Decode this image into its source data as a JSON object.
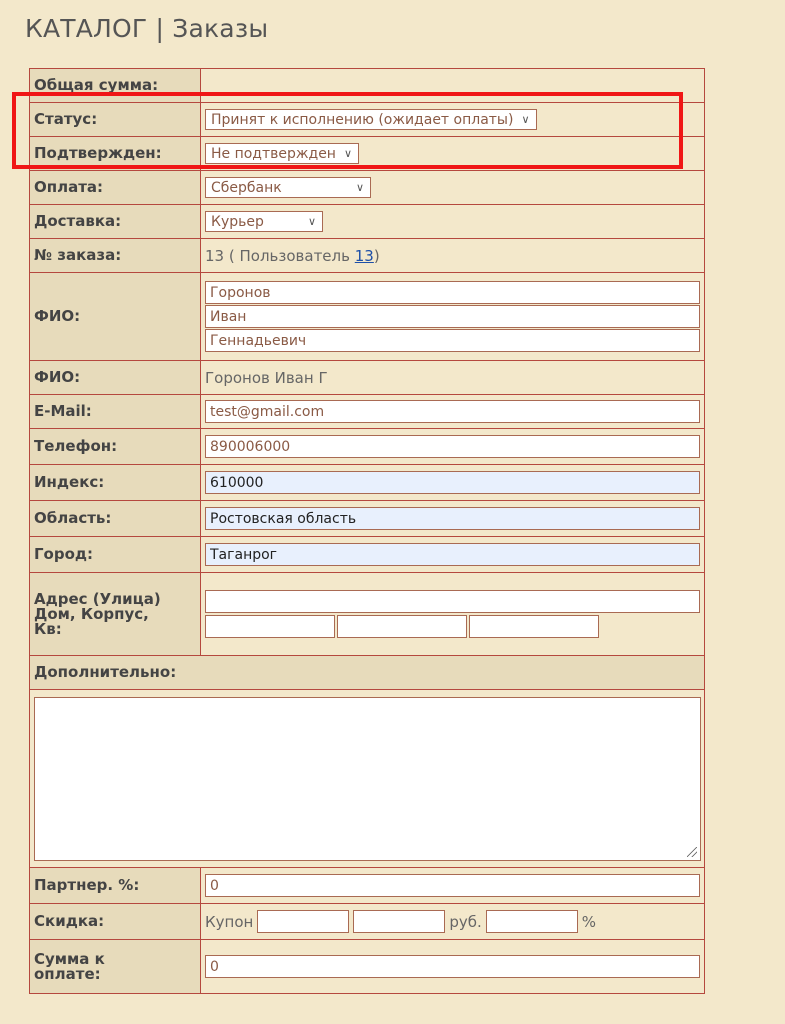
{
  "page": {
    "title": "КАТАЛОГ | Заказы"
  },
  "form": {
    "total_label": "Общая сумма:",
    "total_value": "",
    "status_label": "Статус:",
    "status_value": "Принят к исполнению (ожидает оплаты)",
    "confirmed_label": "Подтвержден:",
    "confirmed_value": "Не подтвержден",
    "payment_label": "Оплата:",
    "payment_value": "Сбербанк",
    "delivery_label": "Доставка:",
    "delivery_value": "Курьер",
    "order_no_label": "№ заказа:",
    "order_no_value": "13",
    "order_user_prefix": "( Пользователь",
    "order_user_id": "13",
    "order_user_suffix": ")",
    "fio_label": "ФИО:",
    "fio_last": "Горонов",
    "fio_first": "Иван",
    "fio_middle": "Геннадьевич",
    "fio2_label": "ФИО:",
    "fio2_value": "Горонов Иван Г",
    "email_label": "E-Mail:",
    "email_value": "test@gmail.com",
    "phone_label": "Телефон:",
    "phone_value": "890006000",
    "index_label": "Индекс:",
    "index_value": "610000",
    "region_label": "Область:",
    "region_value": "Ростовская область",
    "city_label": "Город:",
    "city_value": "Таганрог",
    "address_label_1": "Адрес (Улица)",
    "address_label_2": "Дом, Корпус,",
    "address_label_3": "Кв:",
    "address_street": "",
    "address_house": "",
    "address_building": "",
    "address_apt": "",
    "extra_label": "Дополнительно:",
    "extra_value": "",
    "partner_label": "Партнер. %:",
    "partner_value": "0",
    "discount_label": "Скидка:",
    "coupon_label": "Купон",
    "coupon_value_1": "",
    "coupon_value_2": "",
    "rub_label": "руб.",
    "rub_value": "",
    "percent_label": "%",
    "to_pay_label_1": "Сумма к",
    "to_pay_label_2": "оплате:",
    "to_pay_value": "0"
  },
  "colors": {
    "background": "#f3e8cb",
    "label_bg": "#e7dbbb",
    "border": "#b5483e",
    "highlight": "#f01616",
    "autofill": "#e8f0fd"
  }
}
